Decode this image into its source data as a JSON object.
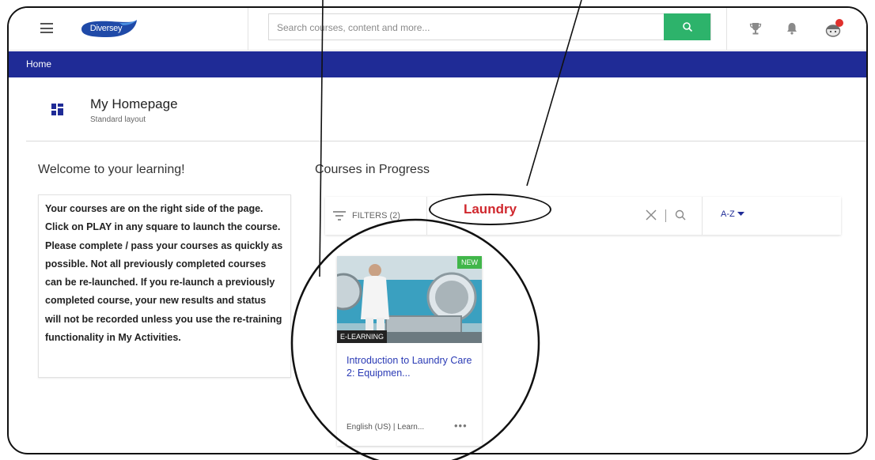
{
  "header": {
    "logo_text": "Diversey",
    "search_placeholder": "Search courses, content and more...",
    "icons": [
      "menu-icon",
      "search-icon",
      "trophy-icon",
      "bell-icon",
      "avatar-icon"
    ],
    "colors": {
      "search_button": "#2db36b",
      "notification_dot": "#e0302c",
      "brand_blue": "#1f2b96"
    }
  },
  "breadcrumb": {
    "home": "Home"
  },
  "page": {
    "title": "My Homepage",
    "subtitle": "Standard layout"
  },
  "left": {
    "heading": "Welcome to your learning!",
    "info": "Your courses are on the right side of the page. Click on PLAY in any square to launch the course. Please complete / pass your courses as quickly as possible. Not all  previously completed courses can be re-launched. If you re-launch a previously completed course, your new results and status will not be recorded unless you use the re-training functionality in My Activities."
  },
  "right": {
    "heading": "Courses in Progress",
    "filters_label": "FILTERS (2)",
    "filter_value": "",
    "sort_label": "A-Z"
  },
  "annotation": {
    "callout": "Laundry",
    "callout_color": "#d0282e"
  },
  "course": {
    "badge": "NEW",
    "type": "E-LEARNING",
    "title": "Introduction to Laundry Care 2: Equipmen...",
    "footer": "English (US) | Learn...",
    "more": "•••"
  }
}
